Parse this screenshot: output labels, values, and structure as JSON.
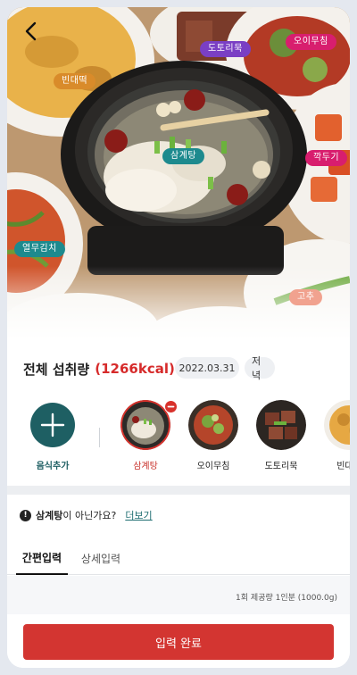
{
  "hero": {
    "tags": [
      {
        "label": "빈대떡"
      },
      {
        "label": "도토리묵"
      },
      {
        "label": "오이무침"
      },
      {
        "label": "삼계탕"
      },
      {
        "label": "깍두기"
      },
      {
        "label": "열무김치"
      },
      {
        "label": "고추"
      }
    ]
  },
  "summary": {
    "title": "전체 섭취량",
    "kcal": "(1266kcal)",
    "date": "2022.03.31",
    "meal": "저녁"
  },
  "foods": {
    "add_label": "음식추가",
    "items": [
      {
        "label": "삼계탕",
        "selected": true
      },
      {
        "label": "오이무침",
        "selected": false
      },
      {
        "label": "도토리묵",
        "selected": false
      },
      {
        "label": "빈대떡",
        "selected": false
      }
    ]
  },
  "question": {
    "food": "삼계탕",
    "suffix": "이 아닌가요?",
    "more": "더보기"
  },
  "tabs": [
    {
      "label": "간편입력",
      "active": true
    },
    {
      "label": "상세입력",
      "active": false
    }
  ],
  "serving": "1회 제공량 1인분 (1000.0g)",
  "submit_label": "입력 완료",
  "colors": {
    "accent": "#d33531",
    "teal": "#1e5f63"
  }
}
